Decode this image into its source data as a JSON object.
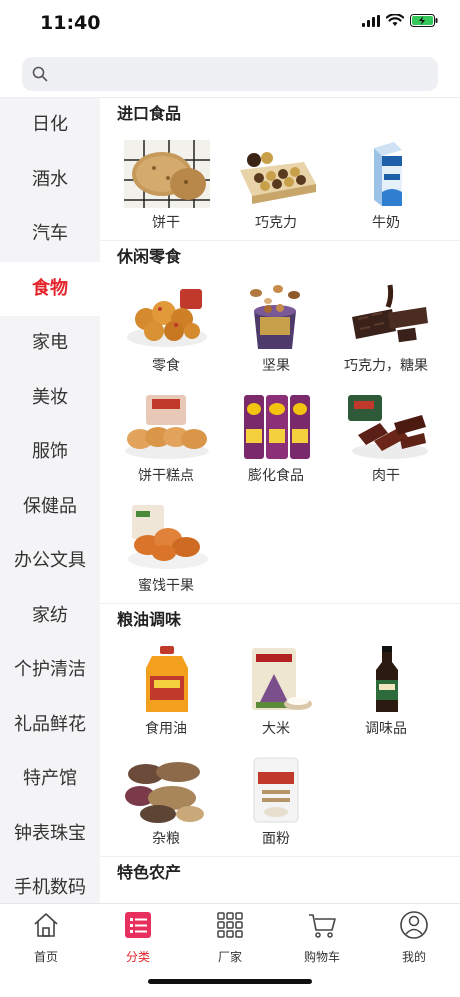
{
  "status_bar": {
    "time": "11:40"
  },
  "search": {
    "placeholder": ""
  },
  "sidebar": {
    "items": [
      "日化",
      "酒水",
      "汽车",
      "食物",
      "家电",
      "美妆",
      "服饰",
      "保健品",
      "办公文具",
      "家纺",
      "个护清洁",
      "礼品鲜花",
      "特产馆",
      "钟表珠宝",
      "手机数码"
    ],
    "active_index": 3
  },
  "sections": [
    {
      "title": "进口食品",
      "items": [
        "饼干",
        "巧克力",
        "牛奶"
      ]
    },
    {
      "title": "休闲零食",
      "items": [
        "零食",
        "坚果",
        "巧克力，糖果",
        "饼干糕点",
        "膨化食品",
        "肉干",
        "蜜饯干果"
      ]
    },
    {
      "title": "粮油调味",
      "items": [
        "食用油",
        "大米",
        "调味品",
        "杂粮",
        "面粉"
      ]
    },
    {
      "title": "特色农产",
      "items": []
    }
  ],
  "tabbar": {
    "home": "首页",
    "category": "分类",
    "factory": "厂家",
    "cart": "购物车",
    "mine": "我的"
  },
  "colors": {
    "accent": "#e3242b",
    "sidebar_bg": "#f4f4f6"
  }
}
